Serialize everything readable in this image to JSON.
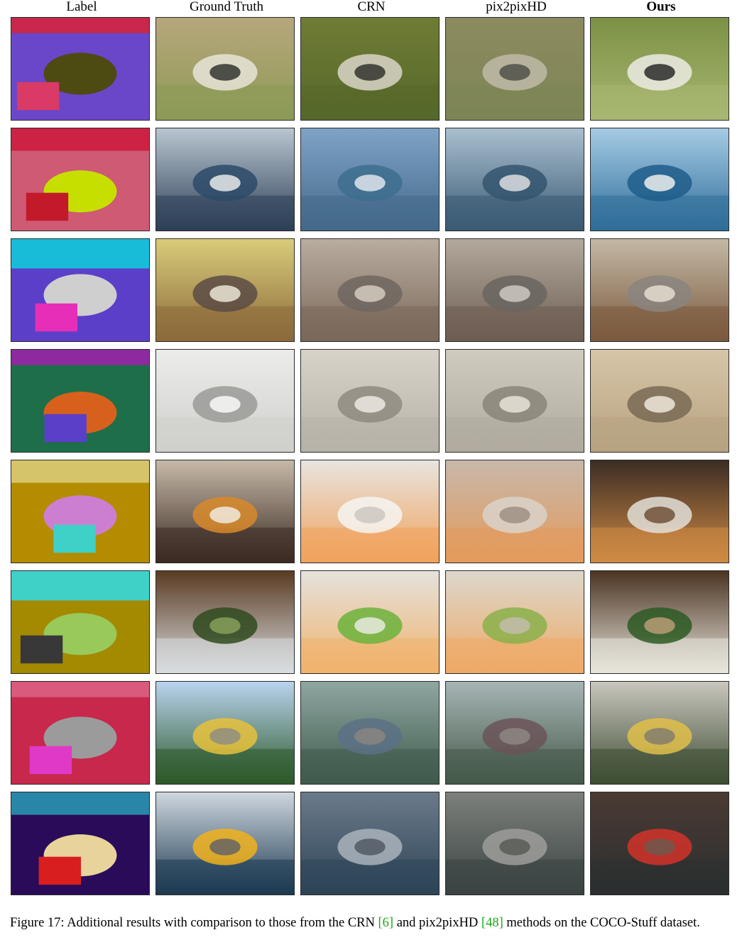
{
  "columns": [
    "Label",
    "Ground Truth",
    "CRN",
    "pix2pixHD",
    "Ours"
  ],
  "rows": [
    {
      "scene": "zebra-on-grass",
      "label_colors": [
        "#6a47c9",
        "#c8284c",
        "#4d4a12",
        "#d93a66"
      ],
      "gt_colors": [
        "#b7a77c",
        "#8d9a55",
        "#e8e4d8",
        "#2b2b28"
      ],
      "crn_colors": [
        "#6f7c34",
        "#56682a",
        "#d9d5c8",
        "#2b2b28"
      ],
      "p2p_colors": [
        "#8c8b60",
        "#7e8555",
        "#bfbaa8",
        "#4a4a44"
      ],
      "ours_colors": [
        "#7c9145",
        "#a8b771",
        "#ecebe4",
        "#1f1f1f"
      ]
    },
    {
      "scene": "harbor-boats",
      "label_colors": [
        "#cf5a73",
        "#cc2244",
        "#c7df00",
        "#c21a2b"
      ],
      "gt_colors": [
        "#b9c6d1",
        "#2e4057",
        "#2b4a68",
        "#f2f2f0"
      ],
      "crn_colors": [
        "#7fa3c6",
        "#44698a",
        "#3d6d8e",
        "#e9eef2"
      ],
      "p2p_colors": [
        "#a9bfd0",
        "#3a5a73",
        "#34556f",
        "#e6e6e6"
      ],
      "ours_colors": [
        "#a6cbe5",
        "#2f6d99",
        "#1f5d8a",
        "#f7f7f2"
      ]
    },
    {
      "scene": "living-room",
      "label_colors": [
        "#5c3fc9",
        "#18bcd9",
        "#cfcfcf",
        "#e62eb8"
      ],
      "gt_colors": [
        "#d8cc7a",
        "#8c6a3a",
        "#5a4b45",
        "#f2efe0"
      ],
      "crn_colors": [
        "#b9ada0",
        "#7a685a",
        "#6e6660",
        "#d9d2c6"
      ],
      "p2p_colors": [
        "#b3a99c",
        "#6d5d52",
        "#6a6560",
        "#d3cec5"
      ],
      "ours_colors": [
        "#c3b8a5",
        "#7b5a3e",
        "#8a8580",
        "#e8e2d6"
      ]
    },
    {
      "scene": "bathroom-sink",
      "label_colors": [
        "#1f6e4a",
        "#8e2aa0",
        "#d7611c",
        "#5b3fc9"
      ],
      "gt_colors": [
        "#ececea",
        "#cfcfcc",
        "#9a9a98",
        "#ffffff"
      ],
      "crn_colors": [
        "#d7d3c9",
        "#b7b2a7",
        "#8f8a80",
        "#f2efe8"
      ],
      "p2p_colors": [
        "#cfcbbf",
        "#b0ab9f",
        "#8a8579",
        "#ede9df"
      ],
      "ours_colors": [
        "#d6c5a8",
        "#b7a381",
        "#7a6a55",
        "#f5efe2"
      ]
    },
    {
      "scene": "pizza-and-beer",
      "label_colors": [
        "#b38c00",
        "#d6c46a",
        "#cc7fd0",
        "#3fd1c7"
      ],
      "gt_colors": [
        "#c7b9a8",
        "#3a2a22",
        "#d88a2a",
        "#f3efe9"
      ],
      "crn_colors": [
        "#e8e4e0",
        "#f0a35c",
        "#f6f5f2",
        "#c9c4be"
      ],
      "p2p_colors": [
        "#c8b8aa",
        "#e39a5c",
        "#d9d2ca",
        "#9a8d80"
      ],
      "ours_colors": [
        "#3c2d25",
        "#cf8a44",
        "#e2dfd8",
        "#6b4a30"
      ]
    },
    {
      "scene": "plate-with-broccoli",
      "label_colors": [
        "#a48a00",
        "#3fd1c7",
        "#98c95a",
        "#383838"
      ],
      "gt_colors": [
        "#5a3b22",
        "#d9dde0",
        "#2f4a1f",
        "#8ca35c"
      ],
      "crn_colors": [
        "#e5e2dc",
        "#f0b36d",
        "#6cb33c",
        "#efede8"
      ],
      "p2p_colors": [
        "#ddd7cc",
        "#eeaa66",
        "#8ab04a",
        "#c5bdb1"
      ],
      "ours_colors": [
        "#4b3422",
        "#e8e5dc",
        "#2d5a23",
        "#bfa079"
      ]
    },
    {
      "scene": "train-in-forest",
      "label_colors": [
        "#c8284c",
        "#d95a7a",
        "#9b9b9b",
        "#e039c8"
      ],
      "gt_colors": [
        "#b9d3ee",
        "#2d5a2a",
        "#e7c13c",
        "#8b8b86"
      ],
      "crn_colors": [
        "#8fa6a1",
        "#3f5b4c",
        "#5b7186",
        "#8c8680"
      ],
      "p2p_colors": [
        "#a6b5b5",
        "#465a4a",
        "#6b5358",
        "#8f8a84"
      ],
      "ours_colors": [
        "#c9c6be",
        "#3e4e33",
        "#e0c04a",
        "#7e7a70"
      ]
    },
    {
      "scene": "canal-boat",
      "label_colors": [
        "#2a0b5a",
        "#2a86a8",
        "#e8d49a",
        "#d81e1e"
      ],
      "gt_colors": [
        "#cfd7df",
        "#1c3a52",
        "#f0b21c",
        "#5e6066"
      ],
      "crn_colors": [
        "#6b7a8a",
        "#2e4558",
        "#a9b3bc",
        "#4c5560"
      ],
      "p2p_colors": [
        "#7d807c",
        "#3a4442",
        "#9e9e9a",
        "#555853"
      ],
      "ours_colors": [
        "#4a3a33",
        "#2b2f30",
        "#d2322a",
        "#6a5a50"
      ]
    }
  ],
  "caption": {
    "figure": "Figure 17:",
    "text_a": "Additional results with comparison to those from the CRN",
    "cite_1": "[6]",
    "text_b": "and pix2pixHD",
    "cite_2": "[48]",
    "text_c": "methods on the COCO-Stuff dataset."
  }
}
